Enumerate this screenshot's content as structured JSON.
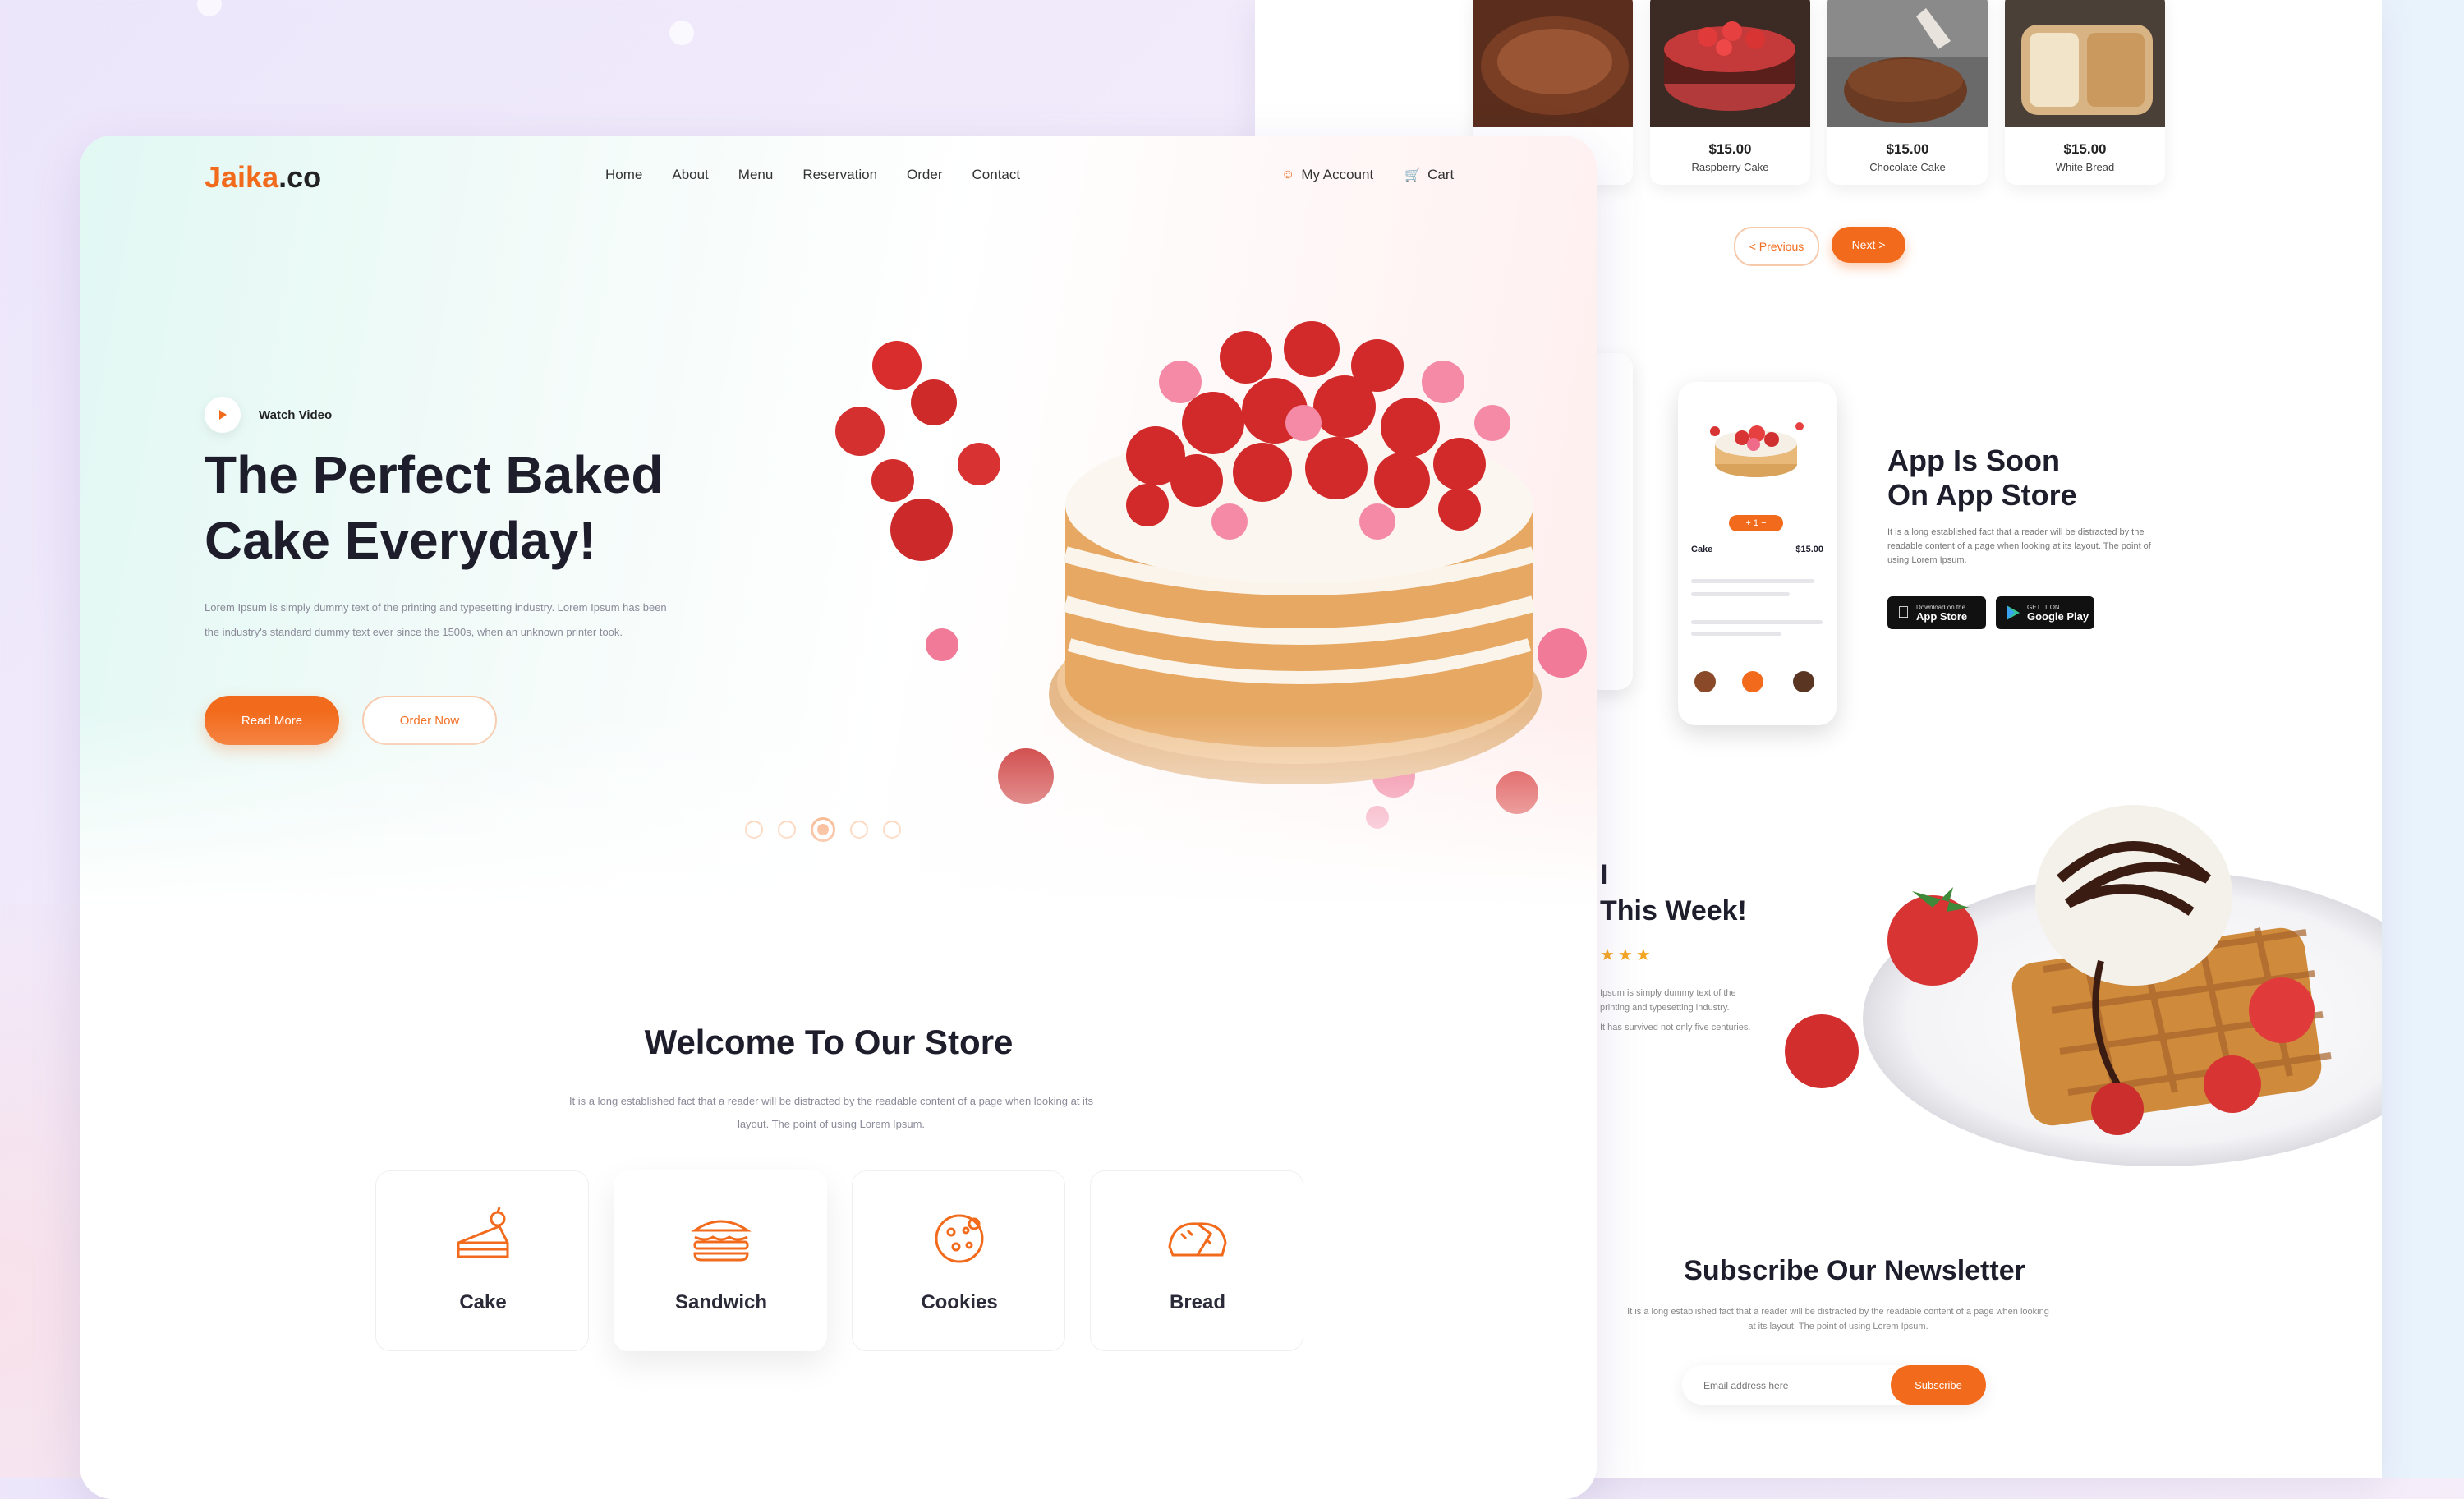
{
  "brand": {
    "name": "Jaika",
    "suffix": ".co",
    "accent": "#f26a1b"
  },
  "nav": {
    "items": [
      "Home",
      "About",
      "Menu",
      "Reservation",
      "Order",
      "Contact"
    ],
    "account": "My Account",
    "cart": "Cart"
  },
  "hero": {
    "watch_video": "Watch Video",
    "title_line1": "The Perfect Baked",
    "title_line2": "Cake Everyday!",
    "description": "Lorem Ipsum is simply dummy text of the printing and typesetting industry. Lorem Ipsum has been the industry's standard dummy text ever since the 1500s, when an unknown printer took.",
    "primary_button": "Read More",
    "secondary_button": "Order Now",
    "slides_count": 5,
    "active_slide": 3
  },
  "welcome": {
    "title": "Welcome To Our Store",
    "description": "It is a long established fact that a reader will be distracted by the readable content of a page when looking at its layout. The point of using Lorem Ipsum."
  },
  "categories": [
    {
      "label": "Cake",
      "icon": "cake-slice-icon"
    },
    {
      "label": "Sandwich",
      "icon": "sandwich-icon"
    },
    {
      "label": "Cookies",
      "icon": "cookie-icon"
    },
    {
      "label": "Bread",
      "icon": "bread-icon"
    }
  ],
  "products": [
    {
      "price": "",
      "name": ""
    },
    {
      "price": "$15.00",
      "name": "Raspberry Cake"
    },
    {
      "price": "$15.00",
      "name": "Chocolate Cake"
    },
    {
      "price": "$15.00",
      "name": "White Bread"
    }
  ],
  "pager": {
    "prev": "< Previous",
    "next": "Next >"
  },
  "app": {
    "title_line1": "App Is Soon",
    "title_line2": "On App Store",
    "description": "It is a long established fact that a reader will be distracted by the readable content of a page when looking at its layout. The point of using Lorem Ipsum.",
    "app_store_small": "Download on the",
    "app_store": "App Store",
    "play_store_small": "GET IT ON",
    "play_store": "Google Play",
    "phone_title": "Cake",
    "phone_price": "$15.00"
  },
  "week": {
    "title_line1": "I",
    "title_line2": "This Week!",
    "stars": "★★★",
    "text1": "Ipsum is simply dummy text of the printing and typesetting industry.",
    "text2": "It has survived not only five centuries."
  },
  "newsletter": {
    "title": "Subscribe Our Newsletter",
    "description": "It is a long established fact that a reader will be distracted by the readable content of a page when looking at its layout. The point of using Lorem Ipsum.",
    "placeholder": "Email address here",
    "button": "Subscribe"
  }
}
